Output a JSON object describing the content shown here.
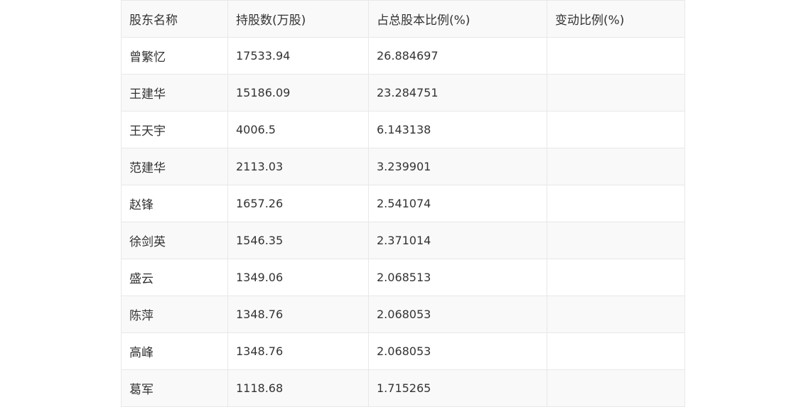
{
  "table": {
    "headers": [
      "股东名称",
      "持股数(万股)",
      "占总股本比例(%)",
      "变动比例(%)"
    ],
    "rows": [
      [
        "曾繁忆",
        "17533.94",
        "26.884697",
        ""
      ],
      [
        "王建华",
        "15186.09",
        "23.284751",
        ""
      ],
      [
        "王天宇",
        "4006.5",
        "6.143138",
        ""
      ],
      [
        "范建华",
        "2113.03",
        "3.239901",
        ""
      ],
      [
        "赵锋",
        "1657.26",
        "2.541074",
        ""
      ],
      [
        "徐剑英",
        "1546.35",
        "2.371014",
        ""
      ],
      [
        "盛云",
        "1349.06",
        "2.068513",
        ""
      ],
      [
        "陈萍",
        "1348.76",
        "2.068053",
        ""
      ],
      [
        "高峰",
        "1348.76",
        "2.068053",
        ""
      ],
      [
        "葛军",
        "1118.68",
        "1.715265",
        ""
      ]
    ]
  },
  "colors": {
    "border": "#e8e8e8",
    "header_bg": "#f9f9f9",
    "stripe_bg": "#f9f9f9",
    "text": "#333333"
  }
}
